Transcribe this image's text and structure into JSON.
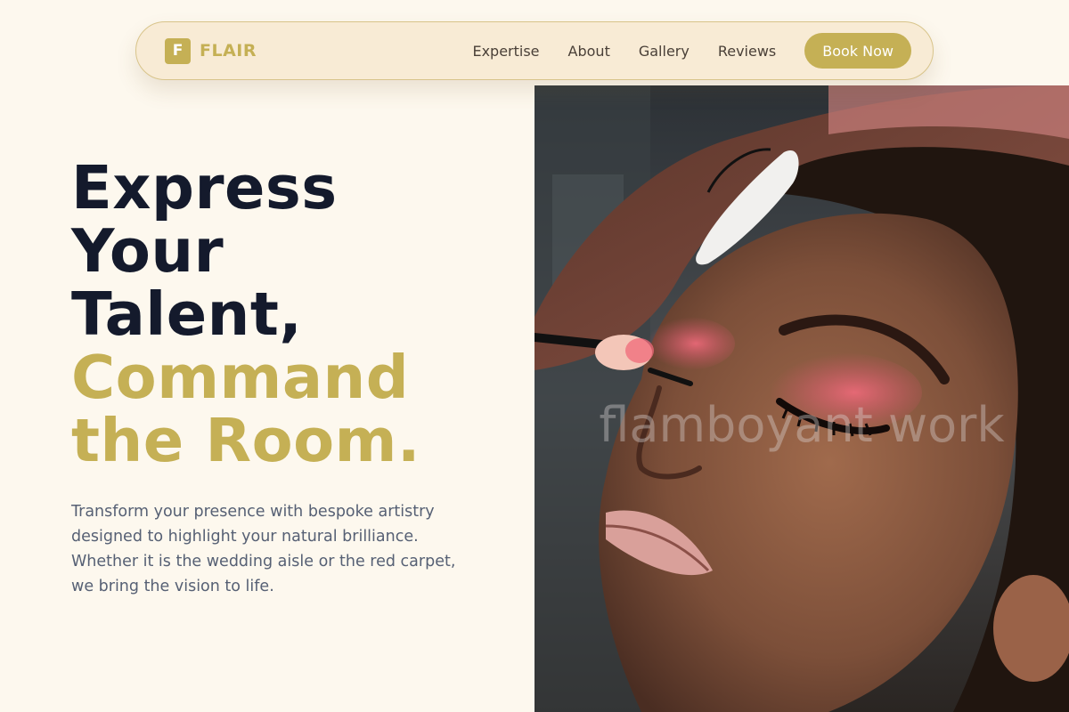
{
  "nav": {
    "logo_letter": "F",
    "brand": "FLAIR",
    "links": [
      "Expertise",
      "About",
      "Gallery",
      "Reviews"
    ],
    "cta": "Book Now"
  },
  "hero": {
    "headline_line1": "Express",
    "headline_line2": "Your",
    "headline_line3": "Talent,",
    "headline_gold1": "Command",
    "headline_gold2": "the Room.",
    "description": "Transform your presence with bespoke artistry designed to highlight your natural brilliance. Whether it is the wedding aisle or the red carpet, we bring the vision to life.",
    "image_watermark": "flamboyant work"
  },
  "colors": {
    "background": "#fdf8ee",
    "accent": "#c5b055",
    "heading": "#141a2c",
    "body_text": "#566074"
  }
}
